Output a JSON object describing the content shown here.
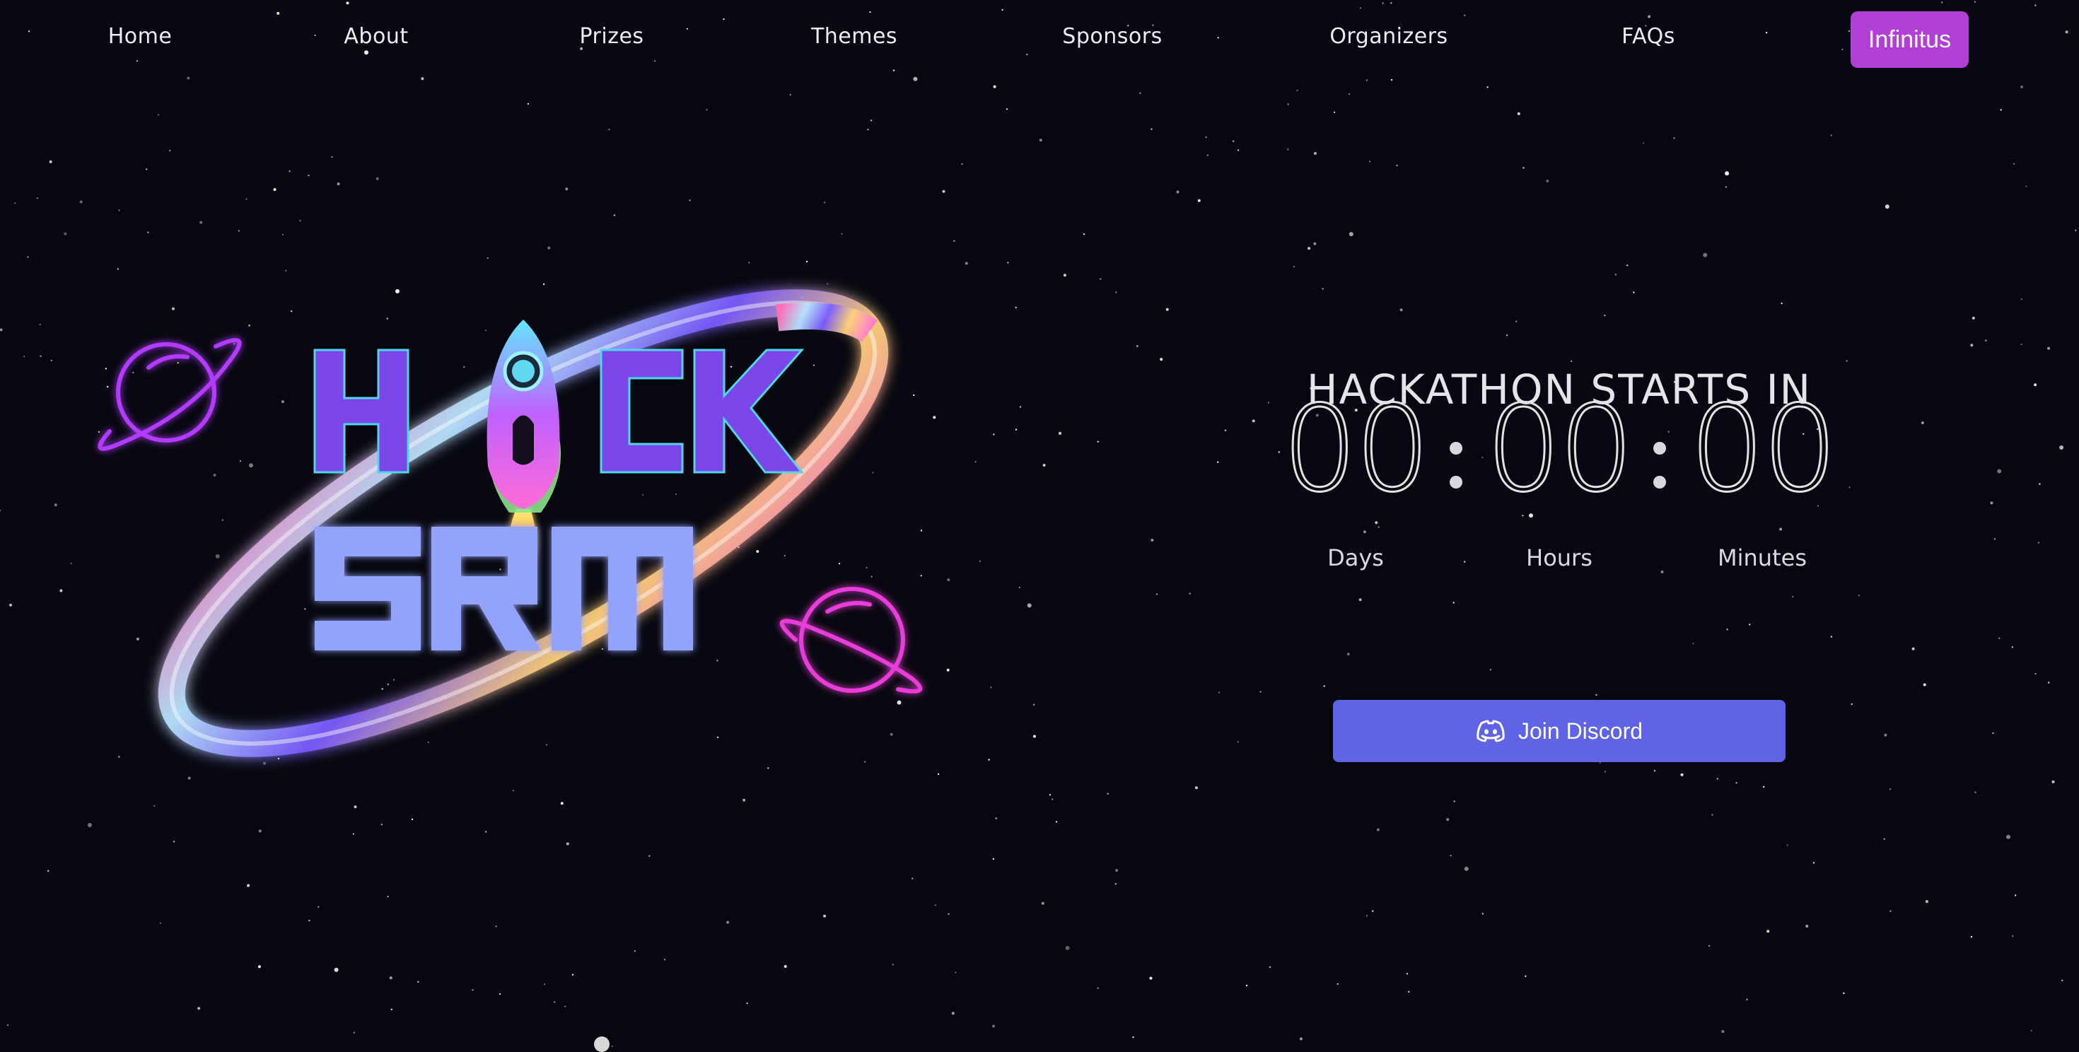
{
  "nav": {
    "items": [
      {
        "label": "Home"
      },
      {
        "label": "About"
      },
      {
        "label": "Prizes"
      },
      {
        "label": "Themes"
      },
      {
        "label": "Sponsors"
      },
      {
        "label": "Organizers"
      },
      {
        "label": "FAQs"
      }
    ],
    "cta_label": "Infinitus"
  },
  "hero": {
    "logo_text_top": "HACK",
    "logo_text_bottom": "SRM"
  },
  "countdown": {
    "title": "HACKATHON STARTS IN",
    "days": "00",
    "hours": "00",
    "minutes": "00",
    "labels": {
      "days": "Days",
      "hours": "Hours",
      "minutes": "Minutes"
    }
  },
  "discord": {
    "label": "Join Discord",
    "icon": "discord-icon"
  },
  "colors": {
    "background": "#07080f",
    "nav_cta": "#b23fd6",
    "discord": "#5f63e6",
    "logo_hack": "#7b47e8",
    "logo_srm": "#93a2fb"
  }
}
